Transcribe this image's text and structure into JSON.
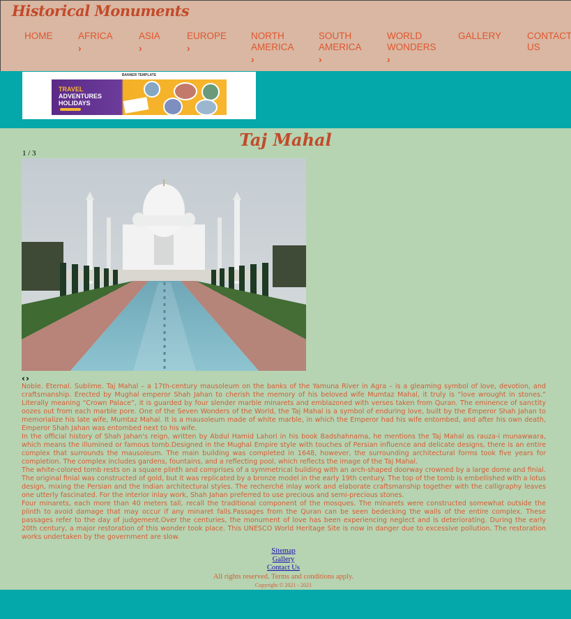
{
  "site": {
    "title": "Historical Monuments"
  },
  "nav": [
    {
      "label": "HOME",
      "chevron": ""
    },
    {
      "label": "AFRICA",
      "chevron": "›"
    },
    {
      "label": "ASIA",
      "chevron": "›"
    },
    {
      "label": "EUROPE",
      "chevron": "›"
    },
    {
      "label": "NORTH AMERICA",
      "chevron": "›"
    },
    {
      "label": "SOUTH AMERICA",
      "chevron": "›"
    },
    {
      "label": "WORLD WONDERS",
      "chevron": "›"
    },
    {
      "label": "GALLERY",
      "chevron": ""
    },
    {
      "label": "CONTACT US",
      "chevron": ""
    }
  ],
  "banner": {
    "caption": "BANNER TEMPLATE",
    "line1": "TRAVEL",
    "line2": "ADVENTURES",
    "line3": "HOLIDAYS"
  },
  "page": {
    "title": "Taj Mahal"
  },
  "slideshow": {
    "counter": "1 / 3",
    "prev": "‹",
    "next": "›"
  },
  "article": {
    "paragraphs": [
      "Noble. Eternal. Sublime. Taj Mahal – a 17th-century mausoleum on the banks of the Yamuna River in Agra – is a gleaming symbol of love, devotion, and craftsmanship. Erected by Mughal emperor Shah Jahan to cherish the memory of his beloved wife Mumtaz Mahal, it truly is “love wrought in stones.” Literally meaning “Crown Palace”, it is guarded by four slender marble minarets and emblazoned with verses taken from Quran. The eminence of sanctity oozes out from each marble pore. One of the Seven Wonders of the World, the Taj Mahal is a symbol of enduring love, built by the Emperor Shah Jahan to memorialize his late wife, Mumtaz Mahal. It is a mausoleum made of white marble, in which the Emperor had his wife entombed, and after his own death, Emperor Shah Jahan was entombed next to his wife.",
      "In the official history of Shah Jahan's reign, written by Abdul Hamid Lahori in his book Badshahnama, he mentions the Taj Mahal as rauza-i munawwara, which means the illumined or famous tomb.Designed in the Mughal Empire style with touches of Persian influence and delicate designs, there is an entire complex that surrounds the mausoleum. The main building was completed in 1648, however, the surrounding architectural forms took five years for completion. The complex includes gardens, fountains, and a reflecting pool, which reflects the image of the Taj Mahal.",
      "The white-colored tomb rests on a square plinth and comprises of a symmetrical building with an arch-shaped doorway crowned by a large dome and finial. The original finial was constructed of gold, but it was replicated by a bronze model in the early 19th century. The top of the tomb is embellished with a lotus design, mixing the Persian and the Indian architectural styles. The recherché inlay work and elaborate craftsmanship together with the calligraphy leaves one utterly fascinated. For the interior inlay work, Shah Jahan preferred to use precious and semi-precious stones.",
      "Four minarets, each more than 40 meters tall, recall the traditional component of the mosques. The minarets were constructed somewhat outside the plinth to avoid damage that may occur if any minaret falls.Passages from the Quran can be seen bedecking the walls of the entire complex. These passages refer to the day of judgement.Over the centuries, the monument of love has been experiencing neglect and is deteriorating. During the early 20th century, a major restoration of this wonder took place. This UNESCO World Heritage Site is now in danger due to excessive pollution. The restoration works undertaken by the government are slow."
    ]
  },
  "footer": {
    "links": [
      "Sitemap",
      "Gallery",
      "Contact Us"
    ],
    "rights": "All rights reserved. Terms and conditions apply.",
    "copyright": "Copyright © 2021 - 2021"
  },
  "colors": {
    "header_bg": "#d9b7a2",
    "body_bg": "#04a8aa",
    "content_bg": "#b6d4b1",
    "accent": "#e0562e"
  }
}
